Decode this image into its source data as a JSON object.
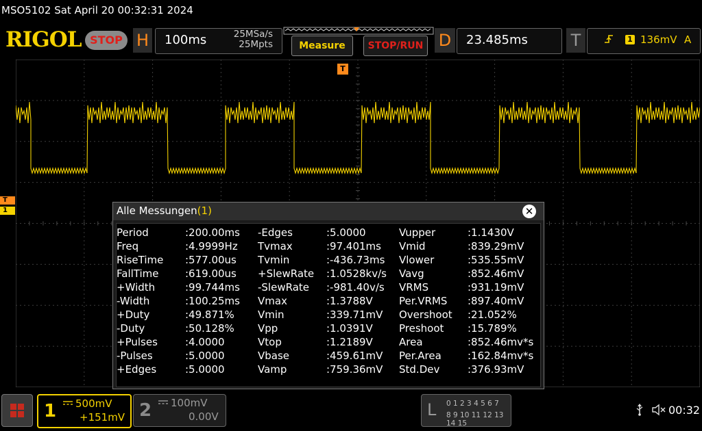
{
  "window": {
    "title": "MSO5102  Sat April 20 00:32:31 2024"
  },
  "brand": {
    "logo": "RIGOL",
    "run_state": "STOP"
  },
  "horizontal": {
    "label": "H",
    "timebase": "100ms",
    "sample_rate": "25MSa/s",
    "memory_depth": "25Mpts"
  },
  "toolbar": {
    "measure_label": "Measure",
    "stop_run_label": "STOP/RUN"
  },
  "delay": {
    "label": "D",
    "value": "23.485ms"
  },
  "trigger": {
    "label": "T",
    "edge_icon": "rising-edge-icon",
    "channel": "1",
    "level": "136mV",
    "mode": "A"
  },
  "markers": {
    "trigger_pos": "T",
    "trigger_level": "T",
    "channel1": "1"
  },
  "measurements": {
    "title": "Alle Messungen",
    "count": "(1)",
    "close": "✕",
    "columns": [
      [
        {
          "name": "Period",
          "value": ":200.00ms"
        },
        {
          "name": "Freq",
          "value": ":4.9999Hz"
        },
        {
          "name": "RiseTime",
          "value": ":577.00us"
        },
        {
          "name": "FallTime",
          "value": ":619.00us"
        },
        {
          "name": "+Width",
          "value": ":99.744ms"
        },
        {
          "name": "-Width",
          "value": ":100.25ms"
        },
        {
          "name": "+Duty",
          "value": ":49.871%"
        },
        {
          "name": "-Duty",
          "value": ":50.128%"
        },
        {
          "name": "+Pulses",
          "value": ":4.0000"
        },
        {
          "name": "-Pulses",
          "value": ":5.0000"
        },
        {
          "name": "+Edges",
          "value": ":5.0000"
        }
      ],
      [
        {
          "name": "-Edges",
          "value": ":5.0000"
        },
        {
          "name": "Tvmax",
          "value": ":97.401ms"
        },
        {
          "name": "Tvmin",
          "value": ":-436.73ms"
        },
        {
          "name": "+SlewRate",
          "value": ":1.0528kv/s"
        },
        {
          "name": "-SlewRate",
          "value": ":-981.40v/s"
        },
        {
          "name": "Vmax",
          "value": ":1.3788V"
        },
        {
          "name": "Vmin",
          "value": ":339.71mV"
        },
        {
          "name": "Vpp",
          "value": ":1.0391V"
        },
        {
          "name": "Vtop",
          "value": ":1.2189V"
        },
        {
          "name": "Vbase",
          "value": ":459.61mV"
        },
        {
          "name": "Vamp",
          "value": ":759.36mV"
        }
      ],
      [
        {
          "name": "Vupper",
          "value": ":1.1430V"
        },
        {
          "name": "Vmid",
          "value": ":839.29mV"
        },
        {
          "name": "Vlower",
          "value": ":535.55mV"
        },
        {
          "name": "Vavg",
          "value": ":852.46mV"
        },
        {
          "name": "VRMS",
          "value": ":931.19mV"
        },
        {
          "name": "Per.VRMS",
          "value": ":897.40mV"
        },
        {
          "name": "Overshoot",
          "value": ":21.052%"
        },
        {
          "name": "Preshoot",
          "value": ":15.789%"
        },
        {
          "name": "Area",
          "value": ":852.46mv*s"
        },
        {
          "name": "Per.Area",
          "value": ":162.84mv*s"
        },
        {
          "name": "Std.Dev",
          "value": ":376.93mV"
        }
      ]
    ]
  },
  "channels": {
    "ch1": {
      "number": "1",
      "scale": "500mV",
      "offset": "+151mV",
      "color": "#f5d200"
    },
    "ch2": {
      "number": "2",
      "scale": "100mV",
      "offset": "0.00V",
      "color": "#8a8a8a"
    }
  },
  "logic": {
    "label": "L",
    "row1": "0 1 2 3   4 5 6 7",
    "row2": "8 9 10 11 12 13 14 15"
  },
  "status": {
    "usb_icon": "usb-icon",
    "speaker_icon": "speaker-muted-icon",
    "clock": "00:32"
  },
  "colors": {
    "trace": "#f5d200",
    "accent": "#ff8a1c",
    "stop_red": "#e0201b"
  }
}
